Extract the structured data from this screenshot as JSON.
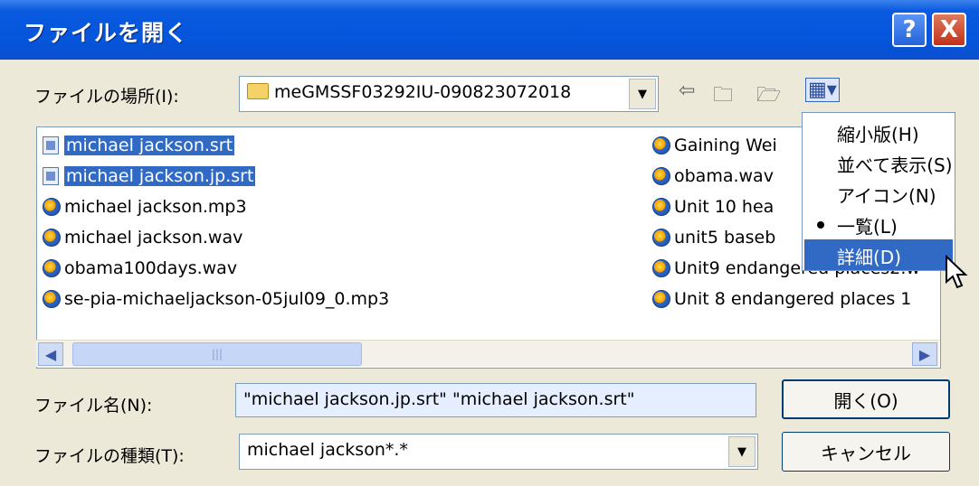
{
  "title": "ファイルを開く",
  "titlebar_buttons": {
    "help": "?",
    "close": "X"
  },
  "location": {
    "label": "ファイルの場所(I):",
    "value": "meGMSSF03292IU-090823072018"
  },
  "files_left": [
    {
      "name": "michael jackson.srt",
      "icon": "subtitle-file-icon",
      "selected": true
    },
    {
      "name": "michael jackson.jp.srt",
      "icon": "subtitle-file-icon",
      "selected": true
    },
    {
      "name": "michael jackson.mp3",
      "icon": "media-file-icon",
      "selected": false
    },
    {
      "name": "michael jackson.wav",
      "icon": "media-file-icon",
      "selected": false
    },
    {
      "name": "obama100days.wav",
      "icon": "media-file-icon",
      "selected": false
    },
    {
      "name": "se-pia-michaeljackson-05jul09_0.mp3",
      "icon": "media-file-icon",
      "selected": false
    }
  ],
  "files_right": [
    {
      "name": "Gaining Wei",
      "icon": "media-file-icon"
    },
    {
      "name": "obama.wav",
      "icon": "media-file-icon"
    },
    {
      "name": "Unit 10 hea",
      "icon": "media-file-icon"
    },
    {
      "name": "unit5 baseb",
      "icon": "media-file-icon"
    },
    {
      "name": "Unit9 endangered places2.w",
      "icon": "media-file-icon"
    },
    {
      "name": "Unit 8 endangered places 1",
      "icon": "media-file-icon"
    }
  ],
  "view_menu": {
    "items": [
      {
        "label": "縮小版(H)",
        "checked": false,
        "highlighted": false
      },
      {
        "label": "並べて表示(S)",
        "checked": false,
        "highlighted": false
      },
      {
        "label": "アイコン(N)",
        "checked": false,
        "highlighted": false
      },
      {
        "label": "一覧(L)",
        "checked": true,
        "highlighted": false
      },
      {
        "label": "詳細(D)",
        "checked": false,
        "highlighted": true
      }
    ]
  },
  "filename": {
    "label": "ファイル名(N):",
    "value": "\"michael jackson.jp.srt\" \"michael jackson.srt\""
  },
  "filetype": {
    "label": "ファイルの種類(T):",
    "value": "michael jackson*.*"
  },
  "buttons": {
    "open": "開く(O)",
    "cancel": "キャンセル"
  },
  "colors": {
    "titlebar": "#0556dc",
    "selection": "#316ac5",
    "panel": "#ece9d8"
  }
}
